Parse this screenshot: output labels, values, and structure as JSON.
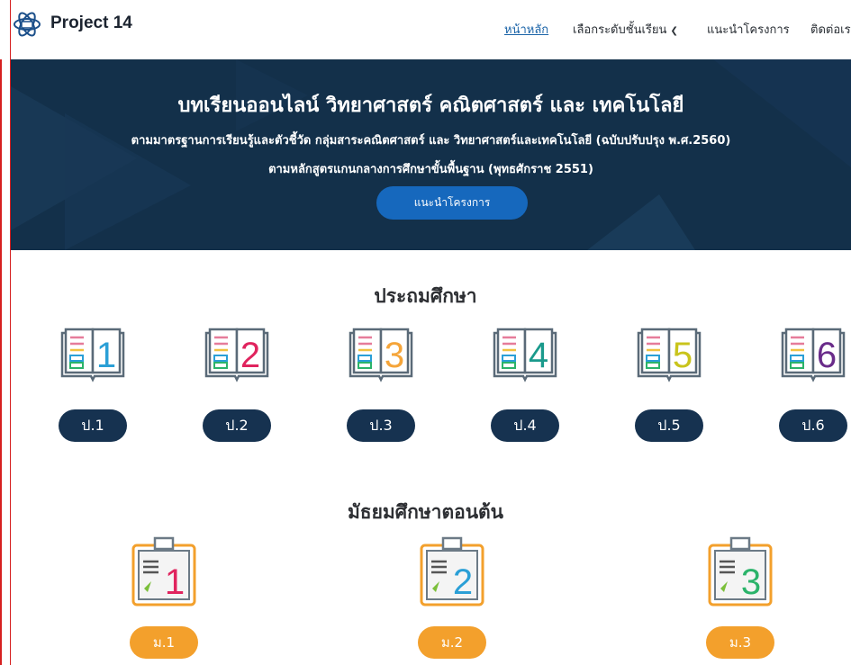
{
  "nav": {
    "brand": "Project 14",
    "items": [
      {
        "label": "หน้าหลัก",
        "active": true
      },
      {
        "label": "เลือกระดับชั้นเรียน",
        "has_dropdown": true
      },
      {
        "label": "แนะนำโครงการ"
      },
      {
        "label": "ติดต่อเร"
      }
    ],
    "logo_icon": "atom-book-icon"
  },
  "hero": {
    "title": "บทเรียนออนไลน์ วิทยาศาสตร์ คณิตศาสตร์ และ เทคโนโลยี",
    "subtitle1": "ตามมาตรฐานการเรียนรู้และตัวชี้วัด กลุ่มสาระคณิตศาสตร์ และ วิทยาศาสตร์และเทคโนโลยี (ฉบับปรับปรุง พ.ศ.2560)",
    "subtitle2": "ตามหลักสูตรแกนกลางการศึกษาขั้นพื้นฐาน (พุทธศักราช 2551)",
    "button_label": "แนะนำโครงการ"
  },
  "primary": {
    "title": "ประถมศึกษา",
    "grades": [
      {
        "number": "1",
        "label": "ป.1",
        "color": "#2a9fd6"
      },
      {
        "number": "2",
        "label": "ป.2",
        "color": "#e0245e"
      },
      {
        "number": "3",
        "label": "ป.3",
        "color": "#f5a53a"
      },
      {
        "number": "4",
        "label": "ป.4",
        "color": "#1a9a8c"
      },
      {
        "number": "5",
        "label": "ป.5",
        "color": "#c9c41c"
      },
      {
        "number": "6",
        "label": "ป.6",
        "color": "#6a2c8a"
      }
    ]
  },
  "secondary": {
    "title": "มัธยมศึกษาตอนต้น",
    "grades": [
      {
        "number": "1",
        "label": "ม.1",
        "color": "#e0245e"
      },
      {
        "number": "2",
        "label": "ม.2",
        "color": "#2a9fd6"
      },
      {
        "number": "3",
        "label": "ม.3",
        "color": "#2bb36a"
      }
    ]
  },
  "colors": {
    "hero_bg": "#13304a",
    "accent_blue": "#1668bd",
    "pill_navy": "#163250",
    "pill_orange": "#f3a02c"
  }
}
